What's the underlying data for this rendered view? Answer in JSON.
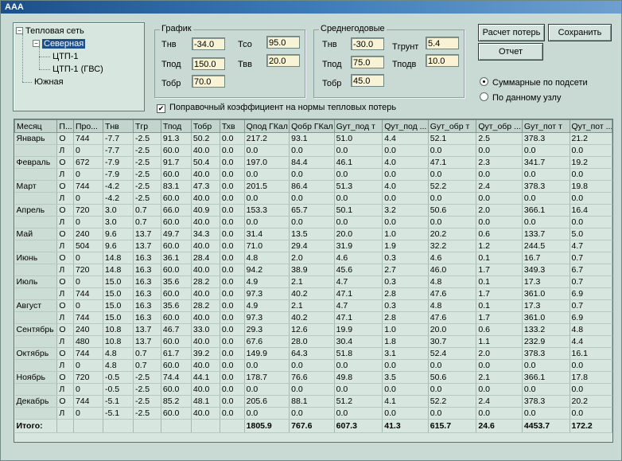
{
  "window": {
    "title": "AAA"
  },
  "tree": {
    "root": "Тепловая сеть",
    "items": [
      {
        "label": "Северная",
        "selected": true
      },
      {
        "label": "ЦТП-1"
      },
      {
        "label": "ЦТП-1 (ГВС)"
      },
      {
        "label": "Южная"
      }
    ]
  },
  "schedule": {
    "title": "График",
    "tnv_label": "Тнв",
    "tnv_value": "-34.0",
    "tpod_label": "Тпод",
    "tpod_value": "150.0",
    "tobr_label": "Тобр",
    "tobr_value": "70.0",
    "tco_label": "Тсо",
    "tco_value": "95.0",
    "tvv_label": "Твв",
    "tvv_value": "20.0"
  },
  "annual": {
    "title": "Среднегодовые",
    "tnv_label": "Тнв",
    "tnv_value": "-30.0",
    "tpod_label": "Тпод",
    "tpod_value": "75.0",
    "tobr_label": "Тобр",
    "tobr_value": "45.0",
    "tgrunt_label": "Тгрунт",
    "tgrunt_value": "5.4",
    "tpodv_label": "Тподв",
    "tpodv_value": "10.0"
  },
  "buttons": {
    "calc": "Расчет потерь",
    "save": "Сохранить",
    "report": "Отчет"
  },
  "radios": {
    "summary": {
      "label": "Суммарные по подсети",
      "checked": true
    },
    "node": {
      "label": "По данному узлу",
      "checked": false
    }
  },
  "checkbox": {
    "label": "Поправочный коэффициент на нормы тепловых потерь",
    "checked": true
  },
  "table": {
    "columns": [
      "Месяц",
      "П...",
      "Про...",
      "Тнв",
      "Тгр",
      "Тпод",
      "Тобр",
      "Тхв",
      "Qпод ГКал",
      "Qобр ГКал",
      "Gут_под т",
      "Qут_под ...",
      "Gут_обр т",
      "Qут_обр ...",
      "Gут_пот т",
      "Qут_пот ..."
    ],
    "rows": [
      [
        "Январь",
        "О",
        "744",
        "-7.7",
        "-2.5",
        "91.3",
        "50.2",
        "0.0",
        "217.2",
        "93.1",
        "51.0",
        "4.4",
        "52.1",
        "2.5",
        "378.3",
        "21.2"
      ],
      [
        "",
        "Л",
        "0",
        "-7.7",
        "-2.5",
        "60.0",
        "40.0",
        "0.0",
        "0.0",
        "0.0",
        "0.0",
        "0.0",
        "0.0",
        "0.0",
        "0.0",
        "0.0"
      ],
      [
        "Февраль",
        "О",
        "672",
        "-7.9",
        "-2.5",
        "91.7",
        "50.4",
        "0.0",
        "197.0",
        "84.4",
        "46.1",
        "4.0",
        "47.1",
        "2.3",
        "341.7",
        "19.2"
      ],
      [
        "",
        "Л",
        "0",
        "-7.9",
        "-2.5",
        "60.0",
        "40.0",
        "0.0",
        "0.0",
        "0.0",
        "0.0",
        "0.0",
        "0.0",
        "0.0",
        "0.0",
        "0.0"
      ],
      [
        "Март",
        "О",
        "744",
        "-4.2",
        "-2.5",
        "83.1",
        "47.3",
        "0.0",
        "201.5",
        "86.4",
        "51.3",
        "4.0",
        "52.2",
        "2.4",
        "378.3",
        "19.8"
      ],
      [
        "",
        "Л",
        "0",
        "-4.2",
        "-2.5",
        "60.0",
        "40.0",
        "0.0",
        "0.0",
        "0.0",
        "0.0",
        "0.0",
        "0.0",
        "0.0",
        "0.0",
        "0.0"
      ],
      [
        "Апрель",
        "О",
        "720",
        "3.0",
        "0.7",
        "66.0",
        "40.9",
        "0.0",
        "153.3",
        "65.7",
        "50.1",
        "3.2",
        "50.6",
        "2.0",
        "366.1",
        "16.4"
      ],
      [
        "",
        "Л",
        "0",
        "3.0",
        "0.7",
        "60.0",
        "40.0",
        "0.0",
        "0.0",
        "0.0",
        "0.0",
        "0.0",
        "0.0",
        "0.0",
        "0.0",
        "0.0"
      ],
      [
        "Май",
        "О",
        "240",
        "9.6",
        "13.7",
        "49.7",
        "34.3",
        "0.0",
        "31.4",
        "13.5",
        "20.0",
        "1.0",
        "20.2",
        "0.6",
        "133.7",
        "5.0"
      ],
      [
        "",
        "Л",
        "504",
        "9.6",
        "13.7",
        "60.0",
        "40.0",
        "0.0",
        "71.0",
        "29.4",
        "31.9",
        "1.9",
        "32.2",
        "1.2",
        "244.5",
        "4.7"
      ],
      [
        "Июнь",
        "О",
        "0",
        "14.8",
        "16.3",
        "36.1",
        "28.4",
        "0.0",
        "4.8",
        "2.0",
        "4.6",
        "0.3",
        "4.6",
        "0.1",
        "16.7",
        "0.7"
      ],
      [
        "",
        "Л",
        "720",
        "14.8",
        "16.3",
        "60.0",
        "40.0",
        "0.0",
        "94.2",
        "38.9",
        "45.6",
        "2.7",
        "46.0",
        "1.7",
        "349.3",
        "6.7"
      ],
      [
        "Июль",
        "О",
        "0",
        "15.0",
        "16.3",
        "35.6",
        "28.2",
        "0.0",
        "4.9",
        "2.1",
        "4.7",
        "0.3",
        "4.8",
        "0.1",
        "17.3",
        "0.7"
      ],
      [
        "",
        "Л",
        "744",
        "15.0",
        "16.3",
        "60.0",
        "40.0",
        "0.0",
        "97.3",
        "40.2",
        "47.1",
        "2.8",
        "47.6",
        "1.7",
        "361.0",
        "6.9"
      ],
      [
        "Август",
        "О",
        "0",
        "15.0",
        "16.3",
        "35.6",
        "28.2",
        "0.0",
        "4.9",
        "2.1",
        "4.7",
        "0.3",
        "4.8",
        "0.1",
        "17.3",
        "0.7"
      ],
      [
        "",
        "Л",
        "744",
        "15.0",
        "16.3",
        "60.0",
        "40.0",
        "0.0",
        "97.3",
        "40.2",
        "47.1",
        "2.8",
        "47.6",
        "1.7",
        "361.0",
        "6.9"
      ],
      [
        "Сентябрь",
        "О",
        "240",
        "10.8",
        "13.7",
        "46.7",
        "33.0",
        "0.0",
        "29.3",
        "12.6",
        "19.9",
        "1.0",
        "20.0",
        "0.6",
        "133.2",
        "4.8"
      ],
      [
        "",
        "Л",
        "480",
        "10.8",
        "13.7",
        "60.0",
        "40.0",
        "0.0",
        "67.6",
        "28.0",
        "30.4",
        "1.8",
        "30.7",
        "1.1",
        "232.9",
        "4.4"
      ],
      [
        "Октябрь",
        "О",
        "744",
        "4.8",
        "0.7",
        "61.7",
        "39.2",
        "0.0",
        "149.9",
        "64.3",
        "51.8",
        "3.1",
        "52.4",
        "2.0",
        "378.3",
        "16.1"
      ],
      [
        "",
        "Л",
        "0",
        "4.8",
        "0.7",
        "60.0",
        "40.0",
        "0.0",
        "0.0",
        "0.0",
        "0.0",
        "0.0",
        "0.0",
        "0.0",
        "0.0",
        "0.0"
      ],
      [
        "Ноябрь",
        "О",
        "720",
        "-0.5",
        "-2.5",
        "74.4",
        "44.1",
        "0.0",
        "178.7",
        "76.6",
        "49.8",
        "3.5",
        "50.6",
        "2.1",
        "366.1",
        "17.8"
      ],
      [
        "",
        "Л",
        "0",
        "-0.5",
        "-2.5",
        "60.0",
        "40.0",
        "0.0",
        "0.0",
        "0.0",
        "0.0",
        "0.0",
        "0.0",
        "0.0",
        "0.0",
        "0.0"
      ],
      [
        "Декабрь",
        "О",
        "744",
        "-5.1",
        "-2.5",
        "85.2",
        "48.1",
        "0.0",
        "205.6",
        "88.1",
        "51.2",
        "4.1",
        "52.2",
        "2.4",
        "378.3",
        "20.2"
      ],
      [
        "",
        "Л",
        "0",
        "-5.1",
        "-2.5",
        "60.0",
        "40.0",
        "0.0",
        "0.0",
        "0.0",
        "0.0",
        "0.0",
        "0.0",
        "0.0",
        "0.0",
        "0.0"
      ]
    ],
    "total": [
      "Итого:",
      "",
      "",
      "",
      "",
      "",
      "",
      "",
      "1805.9",
      "767.6",
      "607.3",
      "41.3",
      "615.7",
      "24.6",
      "4453.7",
      "172.2"
    ]
  }
}
